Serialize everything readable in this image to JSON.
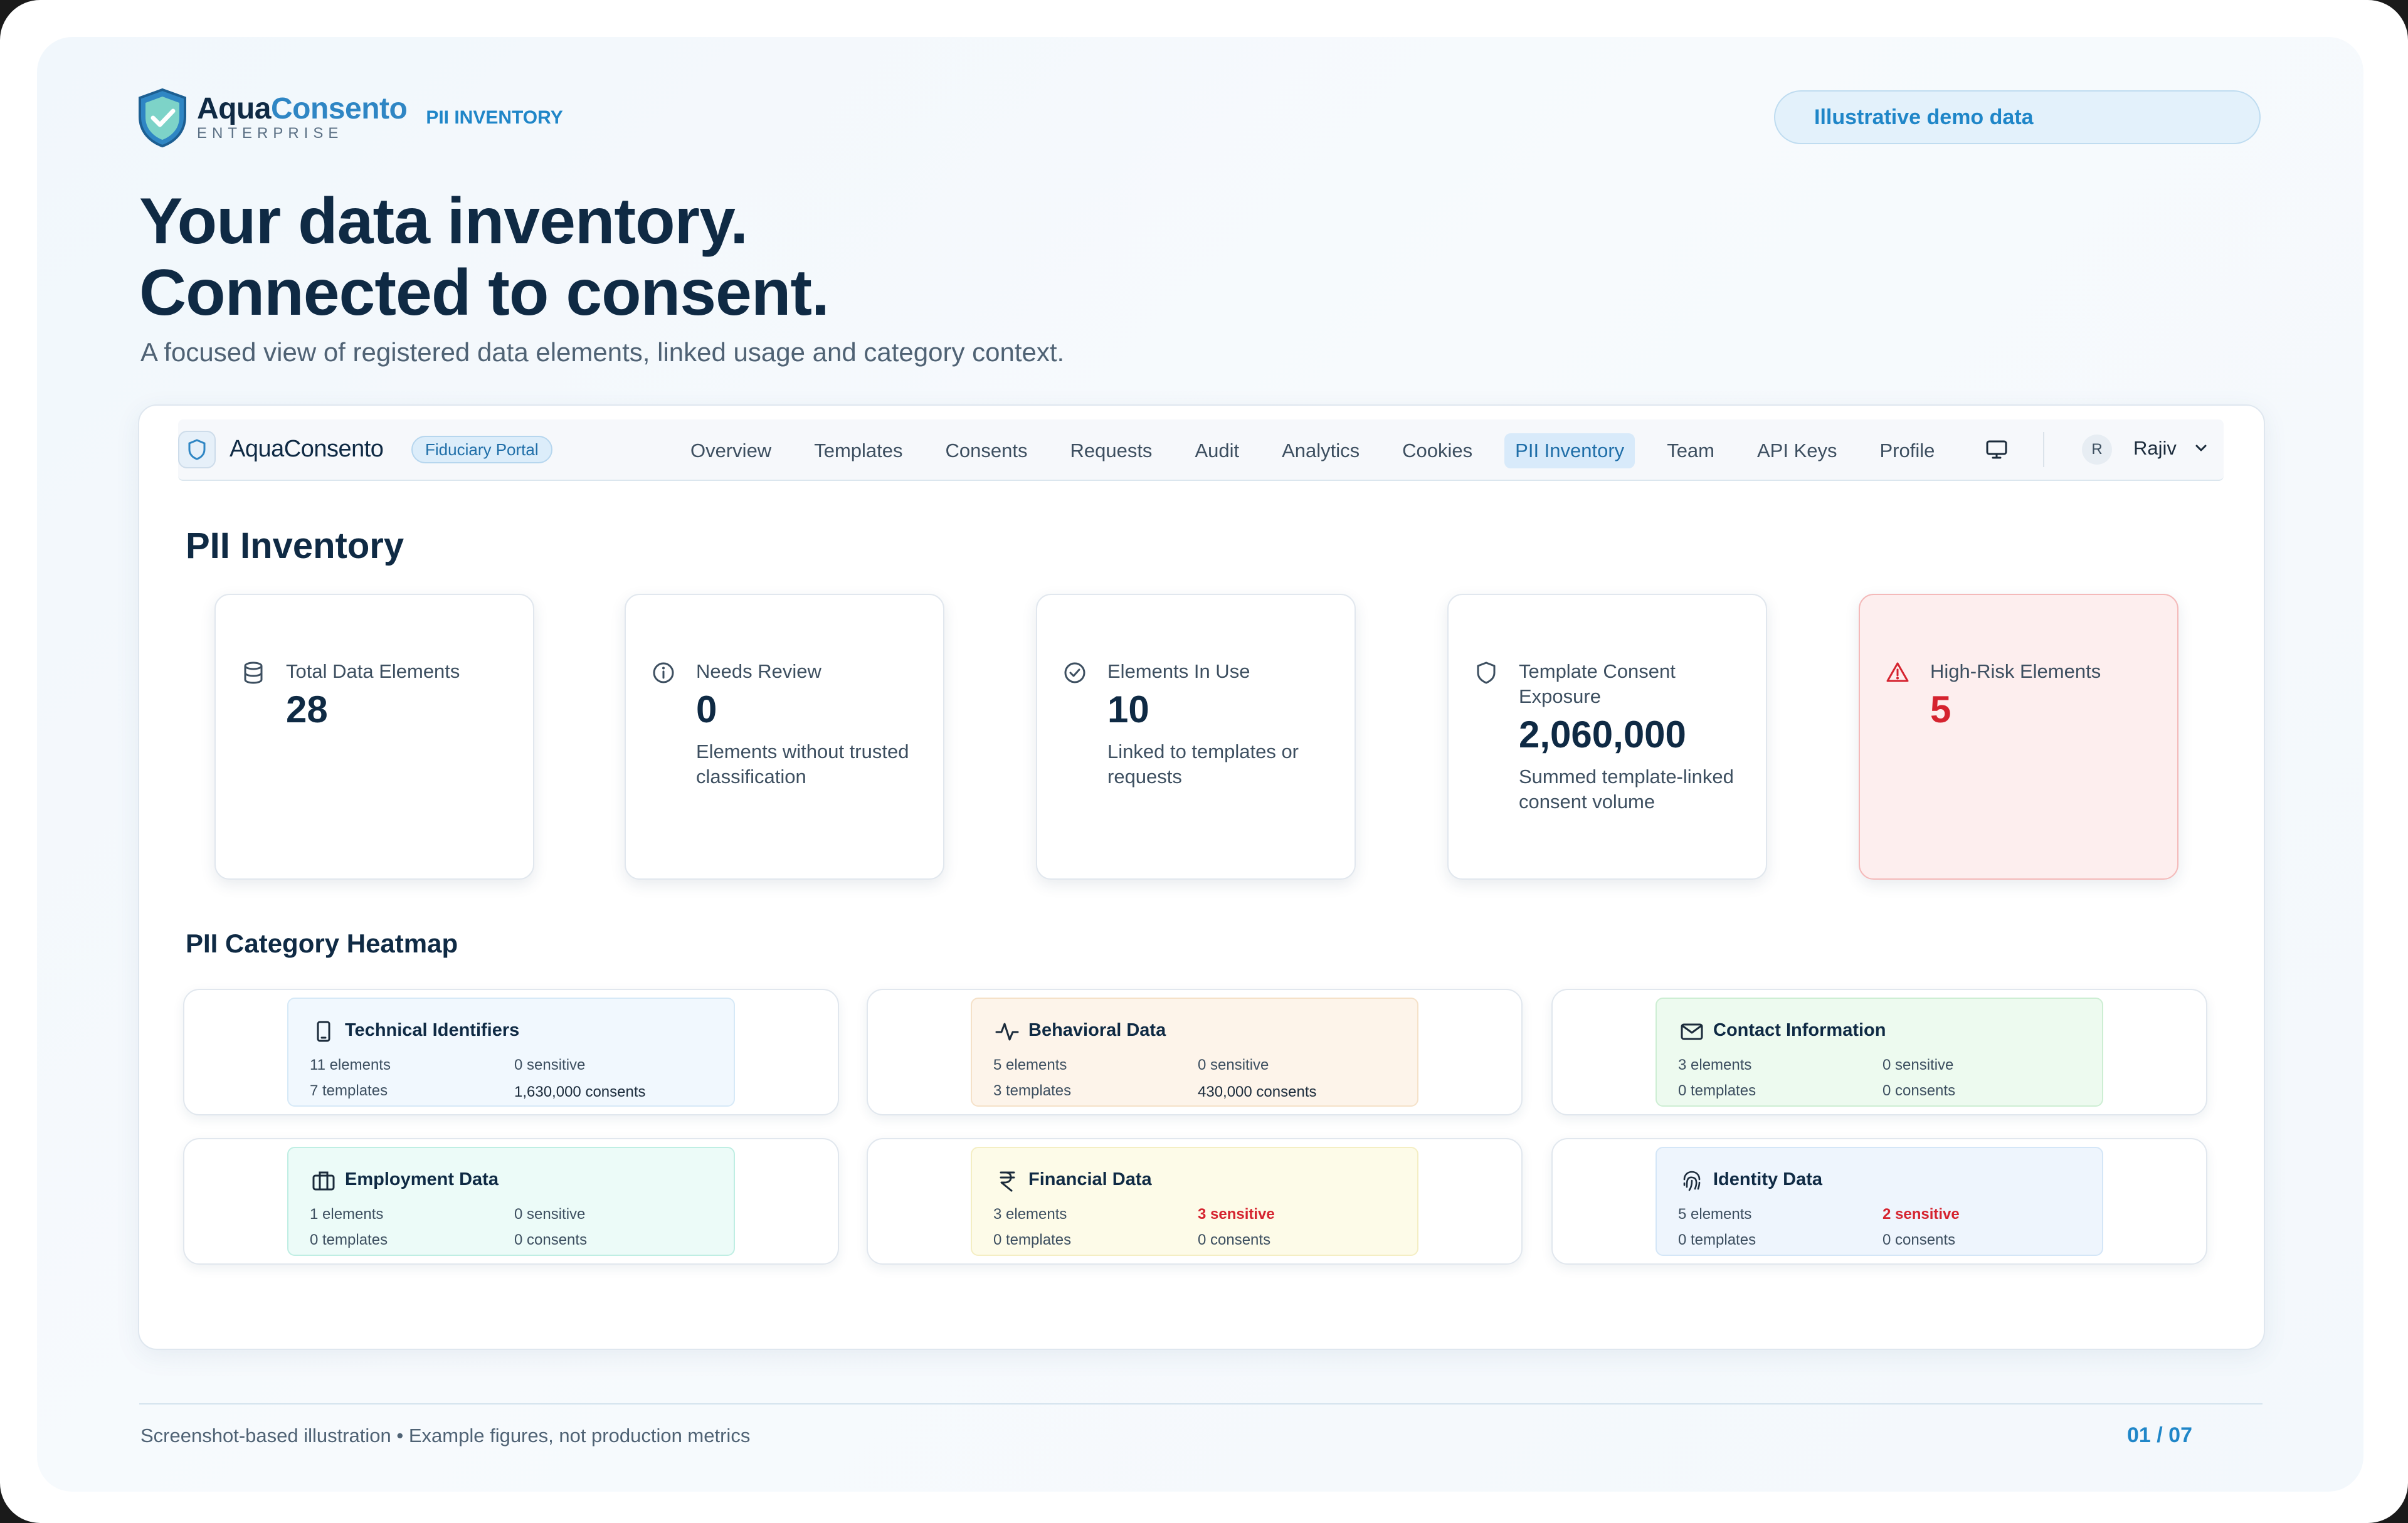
{
  "brand": {
    "name_a": "Aqua",
    "name_b": "Consento",
    "subtitle": "ENTERPRISE",
    "section_tag": "PII INVENTORY"
  },
  "demo_pill": "Illustrative demo data",
  "hero": {
    "line1": "Your data inventory.",
    "line2": "Connected to consent."
  },
  "lede": "A focused view of registered data elements, linked usage and category context.",
  "app": {
    "brand": "AquaConsento",
    "portal_chip": "Fiduciary Portal",
    "nav": [
      "Overview",
      "Templates",
      "Consents",
      "Requests",
      "Audit",
      "Analytics",
      "Cookies",
      "PII Inventory",
      "Team",
      "API Keys",
      "Profile"
    ],
    "active_nav": "PII Inventory",
    "user_initial": "R",
    "user_name": "Rajiv",
    "page_title": "PII Inventory",
    "stats": [
      {
        "label": "Total Data Elements",
        "value": "28",
        "desc": "",
        "icon": "database-icon"
      },
      {
        "label": "Needs Review",
        "value": "0",
        "desc": "Elements without trusted classification",
        "icon": "info-icon"
      },
      {
        "label": "Elements In Use",
        "value": "10",
        "desc": "Linked to templates or requests",
        "icon": "check-circle-icon"
      },
      {
        "label": "Template Consent Exposure",
        "value": "2,060,000",
        "desc": "Summed template-linked consent volume",
        "icon": "shield-icon"
      },
      {
        "label": "High-Risk Elements",
        "value": "5",
        "desc": "",
        "icon": "alert-triangle-icon"
      }
    ],
    "heatmap_title": "PII Category Heatmap",
    "categories": [
      {
        "name": "Technical Identifiers",
        "elements": "11 elements",
        "sensitive": "0 sensitive",
        "templates": "7 templates",
        "consents": "1,630,000 consents",
        "icon": "device-icon",
        "sensitive_flag": false,
        "consents_emph": true,
        "bg": "#f1f8fe",
        "border": "#d6e9f7"
      },
      {
        "name": "Behavioral Data",
        "elements": "5 elements",
        "sensitive": "0 sensitive",
        "templates": "3 templates",
        "consents": "430,000 consents",
        "icon": "activity-icon",
        "sensitive_flag": false,
        "consents_emph": true,
        "bg": "#fdf4ea",
        "border": "#f5e1c8"
      },
      {
        "name": "Contact Information",
        "elements": "3 elements",
        "sensitive": "0 sensitive",
        "templates": "0 templates",
        "consents": "0 consents",
        "icon": "mail-icon",
        "sensitive_flag": false,
        "consents_emph": false,
        "bg": "#edfaef",
        "border": "#cdeed3"
      },
      {
        "name": "Employment Data",
        "elements": "1 elements",
        "sensitive": "0 sensitive",
        "templates": "0 templates",
        "consents": "0 consents",
        "icon": "briefcase-icon",
        "sensitive_flag": false,
        "consents_emph": false,
        "bg": "#ecfbf8",
        "border": "#bfeee3"
      },
      {
        "name": "Financial Data",
        "elements": "3 elements",
        "sensitive": "3 sensitive",
        "templates": "0 templates",
        "consents": "0 consents",
        "icon": "rupee-icon",
        "sensitive_flag": true,
        "consents_emph": false,
        "bg": "#fdfbe8",
        "border": "#f4eec3"
      },
      {
        "name": "Identity Data",
        "elements": "5 elements",
        "sensitive": "2 sensitive",
        "templates": "0 templates",
        "consents": "0 consents",
        "icon": "fingerprint-icon",
        "sensitive_flag": true,
        "consents_emph": false,
        "bg": "#eef5fd",
        "border": "#d4e6f7"
      }
    ]
  },
  "footer": {
    "note": "Screenshot-based illustration • Example figures, not production metrics",
    "page": "01 / 07"
  },
  "colors": {
    "brand_dark": "#0f2a44",
    "brand_accent": "#2f86c4",
    "danger": "#d5232f"
  }
}
